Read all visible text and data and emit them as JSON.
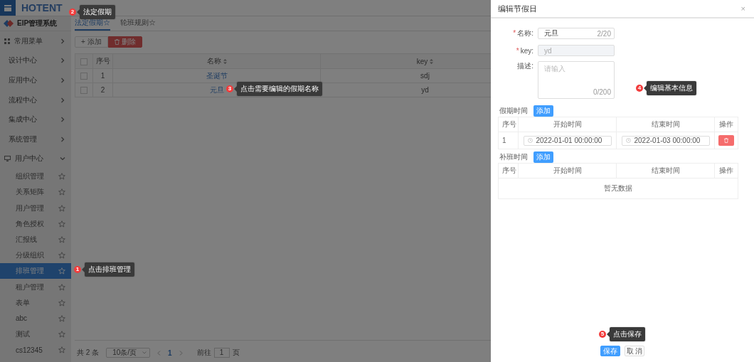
{
  "header": {
    "logo": "HOTENT"
  },
  "sidebar": {
    "title": "EIP管理系统",
    "items": [
      {
        "label": "常用菜单",
        "kind": "favorites",
        "expanded": false
      },
      {
        "label": "设计中心",
        "kind": "group",
        "expanded": false
      },
      {
        "label": "应用中心",
        "kind": "group",
        "expanded": false
      },
      {
        "label": "流程中心",
        "kind": "group",
        "expanded": false
      },
      {
        "label": "集成中心",
        "kind": "group",
        "expanded": false
      },
      {
        "label": "系统管理",
        "kind": "group",
        "expanded": false
      },
      {
        "label": "用户中心",
        "kind": "module",
        "expanded": true,
        "children": [
          {
            "label": "组织管理",
            "selected": false
          },
          {
            "label": "关系矩阵",
            "selected": false
          },
          {
            "label": "用户管理",
            "selected": false
          },
          {
            "label": "角色授权",
            "selected": false
          },
          {
            "label": "汇报线",
            "selected": false
          },
          {
            "label": "分级组织",
            "selected": false
          },
          {
            "label": "排班管理",
            "selected": true
          },
          {
            "label": "租户管理",
            "selected": false
          },
          {
            "label": "表单",
            "selected": false
          },
          {
            "label": "abc",
            "selected": false
          },
          {
            "label": "测试",
            "selected": false
          },
          {
            "label": "cs12345",
            "selected": false
          }
        ]
      }
    ]
  },
  "tabs": [
    {
      "label": "法定假期☆",
      "selected": true
    },
    {
      "label": "轮班规则☆",
      "selected": false
    }
  ],
  "toolbar": [
    {
      "label": "添加",
      "icon_text": "+",
      "kind": "add"
    },
    {
      "label": "删除",
      "kind": "delete"
    }
  ],
  "table": {
    "select_all_checked": false,
    "columns": [
      {
        "label": "序号",
        "sortable": false
      },
      {
        "label": "名称",
        "sortable": true
      },
      {
        "label": "key",
        "sortable": true
      }
    ],
    "rows": [
      {
        "index": "1",
        "name": "圣诞节",
        "key": "sdj",
        "checked": false
      },
      {
        "index": "2",
        "name": "元旦",
        "key": "yd",
        "checked": false
      }
    ]
  },
  "pagination": {
    "total": "共 2 条",
    "page_size": "10条/页",
    "page": "1",
    "goto_label": "前往",
    "goto_value": "1",
    "goto_unit": "页"
  },
  "drawer": {
    "title": "编辑节假日",
    "close": "×",
    "fields": [
      {
        "kind": "input",
        "required_mark": "*",
        "label": "名称:",
        "value": "元旦",
        "counter": "2/20"
      },
      {
        "kind": "disabled",
        "required_mark": "*",
        "label": "key:",
        "value": "yd"
      },
      {
        "kind": "textarea",
        "label": "描述:",
        "placeholder": "请输入",
        "counter": "0/200"
      }
    ],
    "sections": [
      {
        "label": "假期时间",
        "add_button": "添加",
        "columns": [
          "序号",
          "开始时间",
          "结束时间",
          "操作"
        ],
        "rows": [
          {
            "index": "1",
            "start": "2022-01-01 00:00:00",
            "end": "2022-01-03 00:00:00"
          }
        ]
      },
      {
        "label": "补班时间",
        "add_button": "添加",
        "columns": [
          "序号",
          "开始时间",
          "结束时间",
          "操作"
        ],
        "empty_text": "暂无数据"
      }
    ],
    "buttons": [
      {
        "label": "保存",
        "kind": "primary"
      },
      {
        "label": "取 消",
        "kind": "plain"
      }
    ]
  },
  "callouts": [
    {
      "number": "2",
      "text": "法定假期"
    },
    {
      "number": "3",
      "text": "点击需要编辑的假期名称"
    },
    {
      "number": "4",
      "text": "编辑基本信息"
    },
    {
      "number": "1",
      "text": "点击排班管理"
    },
    {
      "number": "5",
      "text": "点击保存"
    }
  ]
}
